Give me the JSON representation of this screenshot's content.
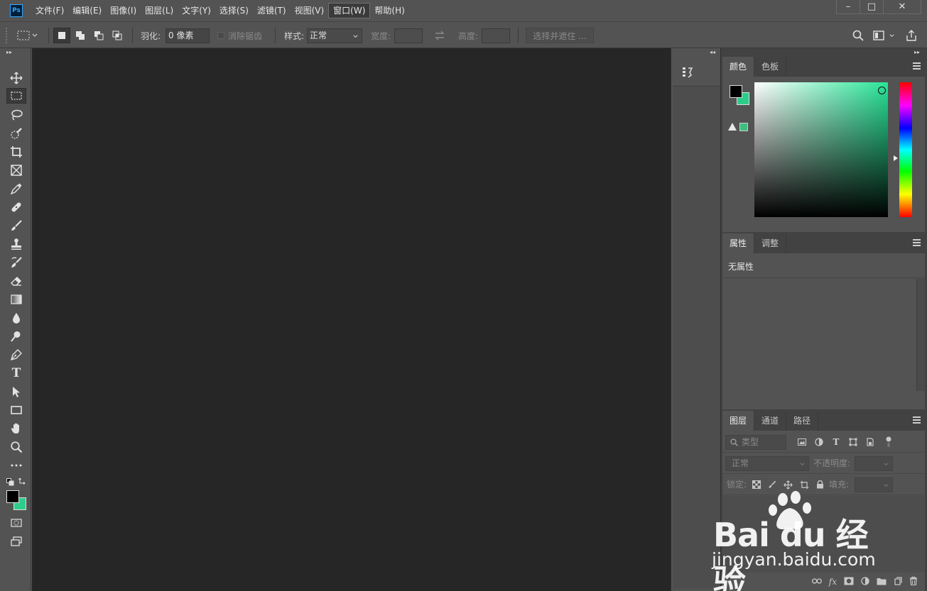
{
  "app": {
    "logo": "Ps"
  },
  "menu": [
    {
      "label": "文件(F)"
    },
    {
      "label": "编辑(E)"
    },
    {
      "label": "图像(I)"
    },
    {
      "label": "图层(L)"
    },
    {
      "label": "文字(Y)"
    },
    {
      "label": "选择(S)"
    },
    {
      "label": "滤镜(T)"
    },
    {
      "label": "视图(V)"
    },
    {
      "label": "窗口(W)"
    },
    {
      "label": "帮助(H)"
    }
  ],
  "window_controls": {
    "minimize": "–",
    "maximize": "□",
    "close": "✕"
  },
  "options": {
    "feather_label": "羽化:",
    "feather_value": "0 像素",
    "antialias_label": "消除锯齿",
    "style_label": "样式:",
    "style_value": "正常",
    "width_label": "宽度:",
    "height_label": "高度:",
    "mask_button": "选择并遮住 ..."
  },
  "colors": {
    "foreground": "#000000",
    "background": "#2ecc8a",
    "accent_ps": "#31a8ff"
  },
  "color_panel": {
    "tabs": [
      {
        "label": "颜色"
      },
      {
        "label": "色板"
      }
    ]
  },
  "properties_panel": {
    "tabs": [
      {
        "label": "属性"
      },
      {
        "label": "调整"
      }
    ],
    "empty_text": "无属性"
  },
  "layers_panel": {
    "tabs": [
      {
        "label": "图层"
      },
      {
        "label": "通道"
      },
      {
        "label": "路径"
      }
    ],
    "filter_placeholder": "类型",
    "blend_mode": "正常",
    "opacity_label": "不透明度:",
    "lock_label": "锁定:",
    "fill_label": "填充:"
  },
  "watermark": {
    "brand": "Bai du 经验",
    "url": "jingyan.baidu.com"
  }
}
